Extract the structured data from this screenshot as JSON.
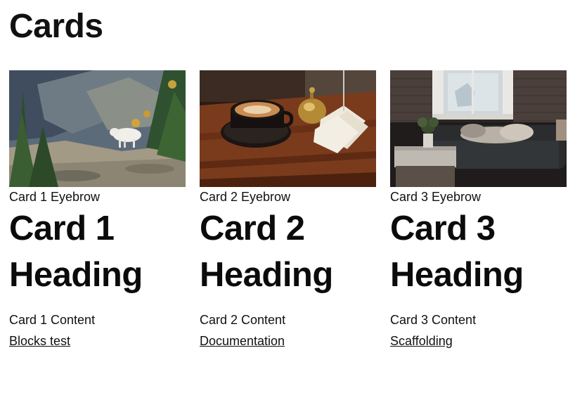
{
  "page": {
    "title": "Cards"
  },
  "cards": [
    {
      "eyebrow": "Card 1 Eyebrow",
      "heading": "Card 1 Heading",
      "content": "Card 1 Content",
      "link": "Blocks test"
    },
    {
      "eyebrow": "Card 2 Eyebrow",
      "heading": "Card 2 Heading",
      "content": "Card 2 Content",
      "link": "Documentation"
    },
    {
      "eyebrow": "Card 3 Eyebrow",
      "heading": "Card 3 Heading",
      "content": "Card 3 Content",
      "link": "Scaffolding"
    }
  ]
}
